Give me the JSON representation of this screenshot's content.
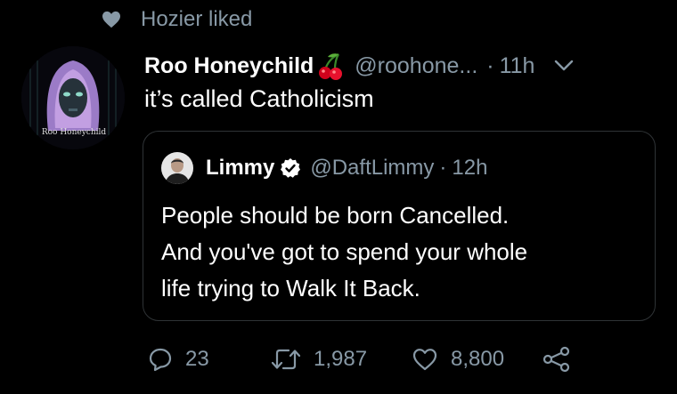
{
  "social_context": {
    "text": "Hozier liked"
  },
  "tweet": {
    "author_name": "Roo Honeychild",
    "handle": "@roohone...",
    "separator": "·",
    "time": "11h",
    "text": "it’s called Catholicism",
    "avatar_caption": "Roo Honeychild"
  },
  "quoted_tweet": {
    "author_name": "Limmy",
    "handle": "@DaftLimmy",
    "separator": "·",
    "time": "12h",
    "text_lines": [
      "People should be born Cancelled.",
      "And you've got to spend your whole",
      "life trying to Walk It Back."
    ]
  },
  "actions": {
    "replies": "23",
    "retweets": "1,987",
    "likes": "8,800"
  },
  "colors": {
    "background": "#000000",
    "secondary_text": "#8899a6",
    "border": "#2f3336",
    "verified": "#ffffff"
  },
  "icons": [
    "heart-icon",
    "cherry-emoji-icon",
    "chevron-down-icon",
    "verified-badge-icon",
    "reply-icon",
    "retweet-icon",
    "like-icon",
    "share-icon"
  ]
}
